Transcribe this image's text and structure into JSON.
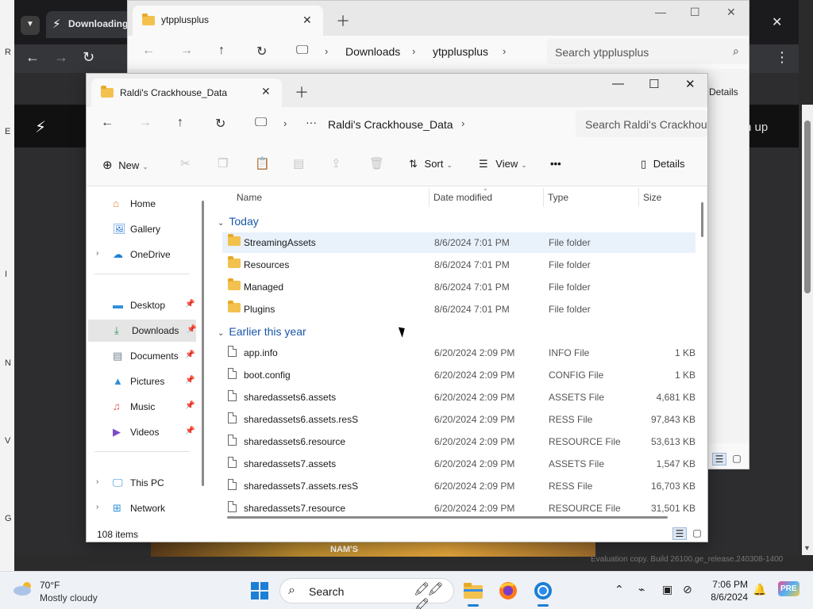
{
  "desktop": {
    "edge_letters": [
      "R",
      "E",
      "I",
      "N",
      "V",
      "G"
    ]
  },
  "chrome": {
    "tab_title": "Downloading",
    "signin_text": "n up",
    "banner_text": "NAM'S",
    "eval_text": "Evaluation copy.  Build 26100.ge_release.240308-1400"
  },
  "back_window": {
    "tab_title": "ytpplusplus",
    "breadcrumbs": [
      "Downloads",
      "ytpplusplus"
    ],
    "search_placeholder": "Search ytpplusplus",
    "details_label": "Details"
  },
  "window": {
    "tab_title": "Raldi's Crackhouse_Data",
    "breadcrumb": "Raldi's Crackhouse_Data",
    "ellipsis": "···",
    "search_placeholder": "Search Raldi's Crackhouse_Data",
    "toolbar": {
      "new_label": "New",
      "sort_label": "Sort",
      "view_label": "View",
      "more_label": "•••",
      "details_label": "Details"
    },
    "nav": {
      "home": "Home",
      "gallery": "Gallery",
      "onedrive": "OneDrive",
      "desktop": "Desktop",
      "downloads": "Downloads",
      "documents": "Documents",
      "pictures": "Pictures",
      "music": "Music",
      "videos": "Videos",
      "thispc": "This PC",
      "network": "Network"
    },
    "columns": {
      "name": "Name",
      "date": "Date modified",
      "type": "Type",
      "size": "Size"
    },
    "groups": {
      "today": "Today",
      "earlier": "Earlier this year"
    },
    "today_rows": [
      {
        "name": "StreamingAssets",
        "date": "8/6/2024 7:01 PM",
        "type": "File folder",
        "size": ""
      },
      {
        "name": "Resources",
        "date": "8/6/2024 7:01 PM",
        "type": "File folder",
        "size": ""
      },
      {
        "name": "Managed",
        "date": "8/6/2024 7:01 PM",
        "type": "File folder",
        "size": ""
      },
      {
        "name": "Plugins",
        "date": "8/6/2024 7:01 PM",
        "type": "File folder",
        "size": ""
      }
    ],
    "earlier_rows": [
      {
        "name": "app.info",
        "date": "6/20/2024 2:09 PM",
        "type": "INFO File",
        "size": "1 KB"
      },
      {
        "name": "boot.config",
        "date": "6/20/2024 2:09 PM",
        "type": "CONFIG File",
        "size": "1 KB"
      },
      {
        "name": "sharedassets6.assets",
        "date": "6/20/2024 2:09 PM",
        "type": "ASSETS File",
        "size": "4,681 KB"
      },
      {
        "name": "sharedassets6.assets.resS",
        "date": "6/20/2024 2:09 PM",
        "type": "RESS File",
        "size": "97,843 KB"
      },
      {
        "name": "sharedassets6.resource",
        "date": "6/20/2024 2:09 PM",
        "type": "RESOURCE File",
        "size": "53,613 KB"
      },
      {
        "name": "sharedassets7.assets",
        "date": "6/20/2024 2:09 PM",
        "type": "ASSETS File",
        "size": "1,547 KB"
      },
      {
        "name": "sharedassets7.assets.resS",
        "date": "6/20/2024 2:09 PM",
        "type": "RESS File",
        "size": "16,703 KB"
      },
      {
        "name": "sharedassets7.resource",
        "date": "6/20/2024 2:09 PM",
        "type": "RESOURCE File",
        "size": "31,501 KB"
      }
    ],
    "status_count": "108 items"
  },
  "taskbar": {
    "temperature": "70°F",
    "weather": "Mostly cloudy",
    "search_label": "Search",
    "time": "7:06 PM",
    "date": "8/6/2024",
    "badge": "PRE"
  },
  "colors": {
    "accent": "#1c7fd6",
    "folder": "#f2c14e",
    "group_header": "#1a56a8",
    "hover_row": "#e9f2fb"
  }
}
